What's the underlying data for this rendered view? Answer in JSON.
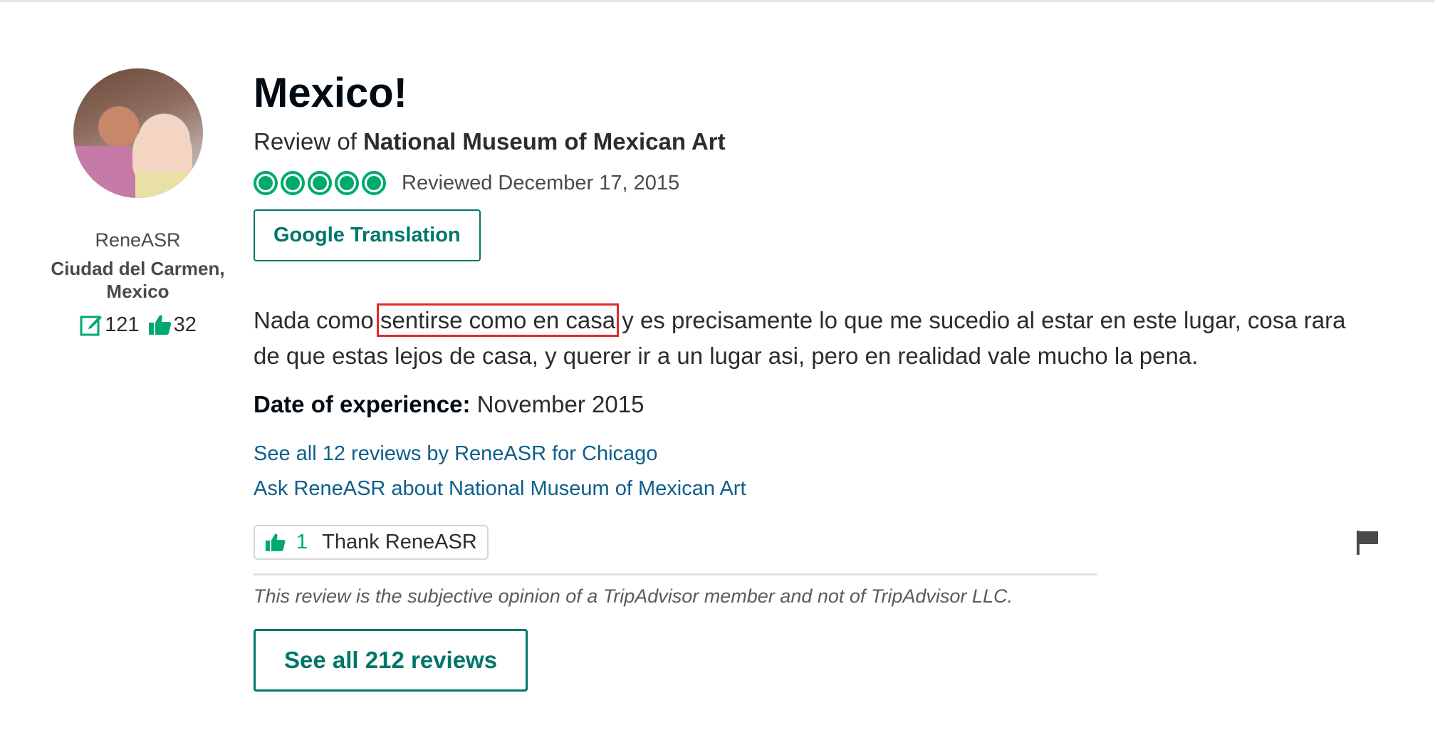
{
  "member": {
    "username": "ReneASR",
    "location": "Ciudad del Carmen, Mexico",
    "contributions": "121",
    "helpful_votes": "32"
  },
  "review": {
    "title": "Mexico!",
    "review_of_prefix": "Review of ",
    "attraction": "National Museum of Mexican Art",
    "rating": 5,
    "rating_max": 5,
    "reviewed_date": "Reviewed December 17, 2015",
    "translate_button": "Google Translation",
    "body_before": "Nada como ",
    "body_highlight": "sentirse como en casa",
    "body_after": " y es precisamente lo que me sucedio al estar en este lugar, cosa rara de que estas lejos de casa, y querer ir a un lugar asi, pero en realidad vale mucho la pena.",
    "date_of_experience_label": "Date of experience:",
    "date_of_experience": " November 2015",
    "see_all_by_user": "See all 12 reviews by ReneASR for Chicago",
    "ask_user": "Ask ReneASR about National Museum of Mexican Art",
    "thank_count": "1",
    "thank_label": "Thank ReneASR",
    "disclaimer": "This review is the subjective opinion of a TripAdvisor member and not of TripAdvisor LLC.",
    "see_all_reviews": "See all 212 reviews"
  },
  "colors": {
    "accent": "#00aa6c",
    "button_text": "#00766a",
    "link": "#0f5e8c",
    "highlight_box": "#e12a2a"
  },
  "icons": {
    "contributions": "pencil-note-icon",
    "helpful": "thumbs-up-icon",
    "flag": "flag-icon"
  }
}
